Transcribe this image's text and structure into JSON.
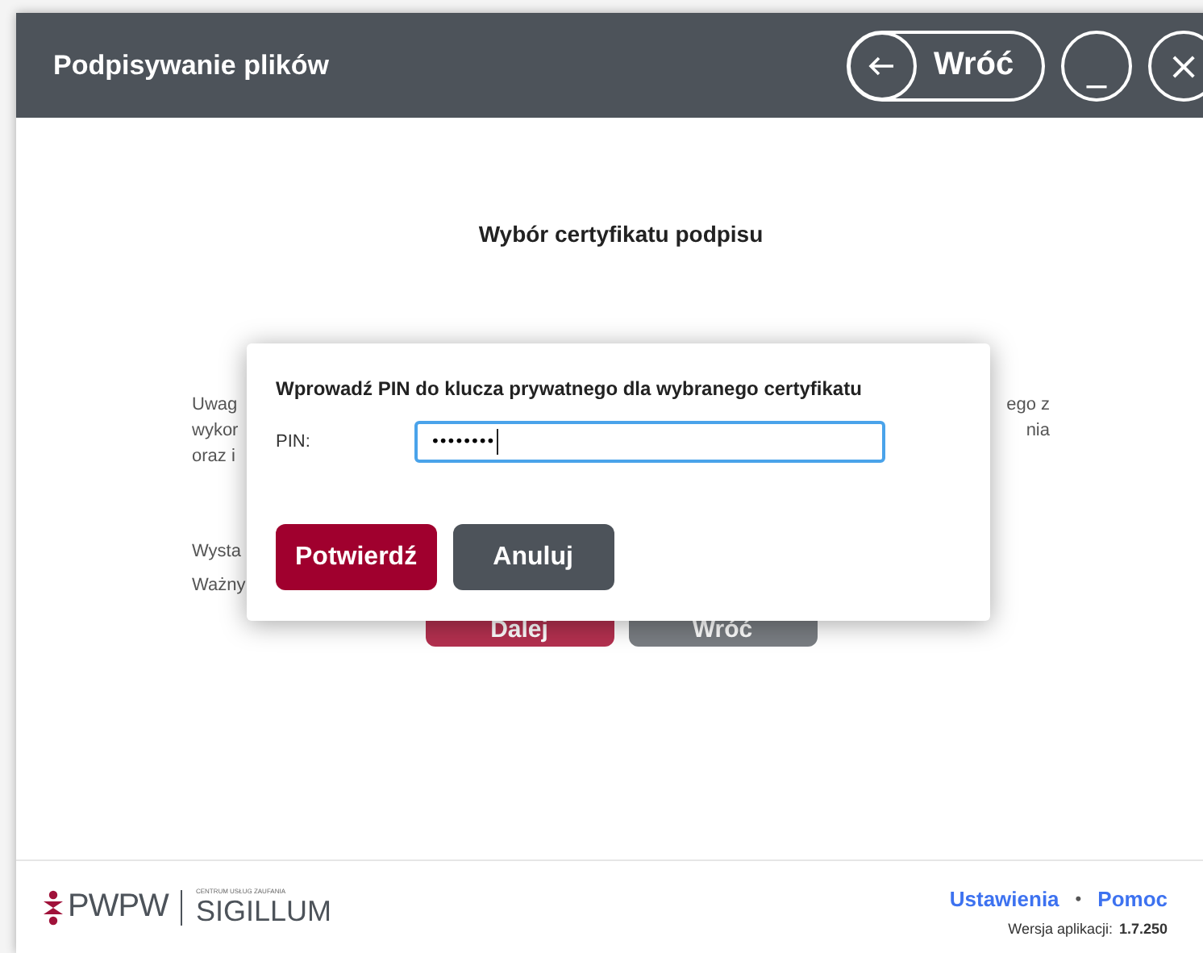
{
  "window": {
    "title": "Podpisywanie plików",
    "back_button": "Wróć",
    "minimize_button": "_",
    "close_button": "×"
  },
  "page": {
    "heading": "Wybór certyfikatu podpisu",
    "left_fragments": [
      "Uwag",
      "wykor",
      "oraz i"
    ],
    "right_fragments": [
      "ego z",
      "nia"
    ],
    "field_fragments": [
      "Wysta",
      "Ważny"
    ],
    "buttons": [
      {
        "label": "Dalej",
        "kind": "primary"
      },
      {
        "label": "Wróć",
        "kind": "secondary"
      }
    ]
  },
  "dialog": {
    "title": "Wprowadź PIN do klucza prywatnego dla wybranego certyfikatu",
    "pin_label": "PIN:",
    "pin_value": "••••••••",
    "buttons": [
      {
        "label": "Potwierdź",
        "kind": "primary"
      },
      {
        "label": "Anuluj",
        "kind": "secondary"
      }
    ]
  },
  "footer": {
    "logo": {
      "brand": "PWPW",
      "tagline": "CENTRUM USŁUG ZAUFANIA",
      "product": "SIGILLUM"
    },
    "links": [
      "Ustawienia",
      "Pomoc"
    ],
    "separator": "•",
    "version_label": "Wersja aplikacji:",
    "version": "1.7.250"
  }
}
